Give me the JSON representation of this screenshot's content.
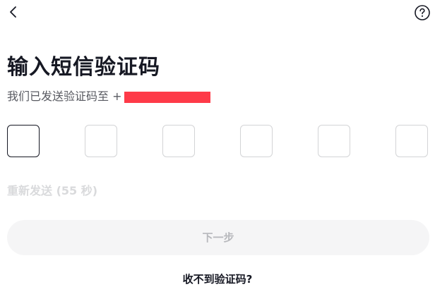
{
  "header": {
    "back_icon": "chevron-left-icon",
    "help_icon": "question-circle-icon"
  },
  "title": "输入短信验证码",
  "subtitle": "我们已发送验证码至 +",
  "code_inputs": [
    "",
    "",
    "",
    "",
    "",
    ""
  ],
  "resend_text": "重新发送 (55 秒)",
  "next_button_label": "下一步",
  "no_code_link": "收不到验证码?",
  "colors": {
    "text_primary": "#161823",
    "text_secondary": "#585a61",
    "disabled_text": "#b7b8bc",
    "button_bg_disabled": "#f5f5f6",
    "redaction": "#fe3a48",
    "input_border": "#d3d4d6",
    "input_border_active": "#161823"
  }
}
